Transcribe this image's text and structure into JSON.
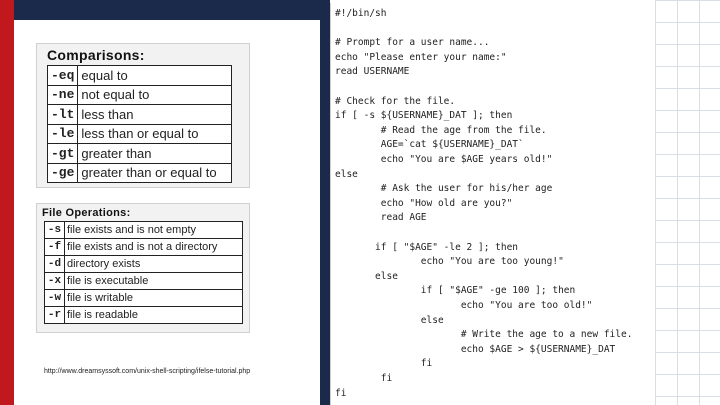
{
  "comparisons": {
    "title": "Comparisons:",
    "rows": [
      {
        "op": "-eq",
        "desc": "equal to"
      },
      {
        "op": "-ne",
        "desc": "not equal to"
      },
      {
        "op": "-lt",
        "desc": "less than"
      },
      {
        "op": "-le",
        "desc": "less than or equal to"
      },
      {
        "op": "-gt",
        "desc": "greater than"
      },
      {
        "op": "-ge",
        "desc": "greater than or equal to"
      }
    ]
  },
  "file_operations": {
    "title": "File Operations:",
    "rows": [
      {
        "op": "-s",
        "desc": "file exists and is not empty"
      },
      {
        "op": "-f",
        "desc": "file exists and is not a directory"
      },
      {
        "op": "-d",
        "desc": "directory exists"
      },
      {
        "op": "-x",
        "desc": "file is executable"
      },
      {
        "op": "-w",
        "desc": "file is writable"
      },
      {
        "op": "-r",
        "desc": "file is readable"
      }
    ]
  },
  "source_link": "http://www.dreamsyssoft.com/unix-shell-scripting/ifelse-tutorial.php",
  "colors": {
    "red_bar": "#c0181c",
    "navy": "#1b2a4a",
    "string_green": "#1a6b1a"
  },
  "code": {
    "lines": [
      {
        "indent": 0,
        "text": "#!/bin/sh",
        "kind": "comment"
      },
      {
        "indent": 0,
        "text": "",
        "kind": "plain"
      },
      {
        "indent": 0,
        "text": "# Prompt for a user name...",
        "kind": "comment"
      },
      {
        "indent": 0,
        "text": "echo \"Please enter your name:\"",
        "kind": "echo"
      },
      {
        "indent": 0,
        "text": "read USERNAME",
        "kind": "plain"
      },
      {
        "indent": 0,
        "text": "",
        "kind": "plain"
      },
      {
        "indent": 0,
        "text": "# Check for the file.",
        "kind": "comment"
      },
      {
        "indent": 0,
        "text": "if [ -s ${USERNAME}_DAT ]; then",
        "kind": "plain"
      },
      {
        "indent": 8,
        "text": "# Read the age from the file.",
        "kind": "comment"
      },
      {
        "indent": 8,
        "text": "AGE=`cat ${USERNAME}_DAT`",
        "kind": "plain"
      },
      {
        "indent": 8,
        "text": "echo \"You are $AGE years old!\"",
        "kind": "echo"
      },
      {
        "indent": 0,
        "text": "else",
        "kind": "plain"
      },
      {
        "indent": 8,
        "text": "# Ask the user for his/her age",
        "kind": "comment"
      },
      {
        "indent": 8,
        "text": "echo \"How old are you?\"",
        "kind": "echo"
      },
      {
        "indent": 8,
        "text": "read AGE",
        "kind": "plain"
      },
      {
        "indent": 0,
        "text": "",
        "kind": "plain"
      },
      {
        "indent": 7,
        "text": "if [ \"$AGE\" -le 2 ]; then",
        "kind": "plain"
      },
      {
        "indent": 15,
        "text": "echo \"You are too young!\"",
        "kind": "echo"
      },
      {
        "indent": 7,
        "text": "else",
        "kind": "plain"
      },
      {
        "indent": 15,
        "text": "if [ \"$AGE\" -ge 100 ]; then",
        "kind": "plain"
      },
      {
        "indent": 22,
        "text": "echo \"You are too old!\"",
        "kind": "echo"
      },
      {
        "indent": 15,
        "text": "else",
        "kind": "plain"
      },
      {
        "indent": 22,
        "text": "# Write the age to a new file.",
        "kind": "comment"
      },
      {
        "indent": 22,
        "text": "echo $AGE > ${USERNAME}_DAT",
        "kind": "plain"
      },
      {
        "indent": 15,
        "text": "fi",
        "kind": "plain"
      },
      {
        "indent": 8,
        "text": "fi",
        "kind": "plain"
      },
      {
        "indent": 0,
        "text": "fi",
        "kind": "plain"
      }
    ]
  }
}
